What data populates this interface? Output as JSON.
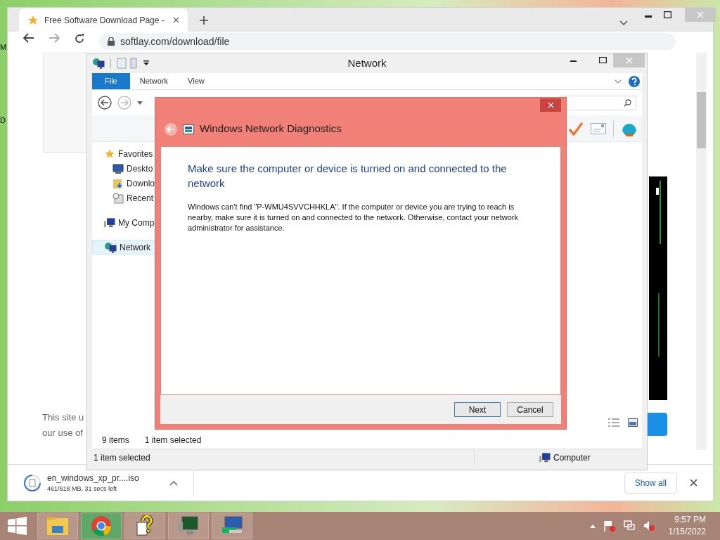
{
  "desktop": {
    "labels": [
      "M",
      "D"
    ]
  },
  "browser": {
    "tab": {
      "title": "Free Software Download Page - ",
      "selected": true
    },
    "address": "softlay.com/download/file",
    "notice": [
      "This site u",
      "our use of"
    ],
    "download": {
      "filename": "en_windows_xp_pr....iso",
      "progress": "461/618 MB, 31 secs left"
    },
    "show_all": "Show all"
  },
  "explorer": {
    "title": "Network",
    "ribbon_tabs": [
      {
        "label": "File",
        "selected": true
      },
      {
        "label": "Network",
        "selected": false
      },
      {
        "label": "View",
        "selected": false
      }
    ],
    "nav_items": [
      {
        "label": "Favorites",
        "kind": "star",
        "selected": false,
        "children": [
          {
            "label": "Deskto",
            "kind": "desktop",
            "selected": false
          },
          {
            "label": "Downlo",
            "kind": "downloads",
            "selected": false
          },
          {
            "label": "Recent",
            "kind": "recent",
            "selected": false
          }
        ]
      },
      {
        "label": "My Comp",
        "kind": "computer",
        "selected": false
      },
      {
        "label": "Network",
        "kind": "network",
        "selected": true
      }
    ],
    "status": {
      "count": "9 items",
      "selection": "1 item selected"
    },
    "details": {
      "selection": "1 item selected",
      "location": "Computer"
    }
  },
  "dialog": {
    "title": "Windows Network Diagnostics",
    "heading": "Make sure the computer or device is turned on and connected to the network",
    "message": "Windows can't find \"P-WMU4SVVCHHKLA\". If the computer or device you are trying to reach is nearby, make sure it is turned on and connected to the network. Otherwise, contact your network administrator for assistance.",
    "buttons": [
      {
        "label": "Next",
        "default": true
      },
      {
        "label": "Cancel",
        "default": false
      }
    ]
  },
  "taskbar": {
    "apps": [
      {
        "kind": "folder",
        "active": false
      },
      {
        "kind": "chrome",
        "active": true
      },
      {
        "kind": "help",
        "active": false
      },
      {
        "kind": "monitor",
        "active": false
      },
      {
        "kind": "network",
        "active": false
      }
    ],
    "time": "9:57 PM",
    "date": "1/15/2022"
  }
}
